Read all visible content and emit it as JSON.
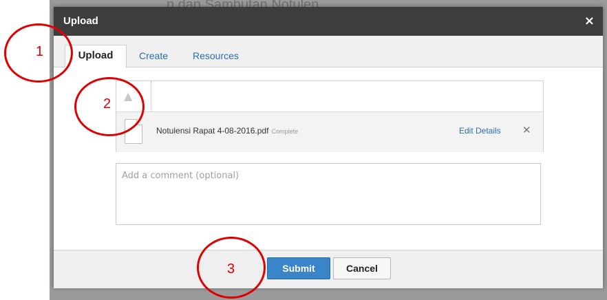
{
  "background": {
    "page_title_fragment": "…n dan Sambutan Notulen…"
  },
  "dialog": {
    "title": "Upload",
    "close_symbol": "×",
    "tabs": [
      {
        "label": "Upload",
        "active": true
      },
      {
        "label": "Create",
        "active": false
      },
      {
        "label": "Resources",
        "active": false
      }
    ]
  },
  "file": {
    "name": "Notulensi Rapat 4-08-2016.pdf",
    "status": "Complete",
    "edit_label": "Edit Details",
    "remove_symbol": "✕"
  },
  "comment": {
    "placeholder": "Add a comment (optional)"
  },
  "buttons": {
    "submit": "Submit",
    "cancel": "Cancel"
  },
  "annotations": [
    "1",
    "2",
    "3"
  ],
  "colors": {
    "titlebar": "#3d3d3d",
    "link": "#2a6db0",
    "submit": "#3a84c9",
    "annotation": "#e00000"
  },
  "icons": {
    "upload": "upload-icon",
    "file": "document-icon",
    "remove": "close-icon",
    "dialog_close": "close-icon"
  }
}
